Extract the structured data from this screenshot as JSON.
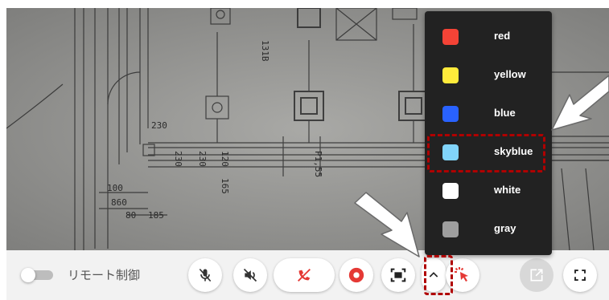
{
  "controls": {
    "remote_control_label": "リモート制御",
    "remote_control_on": false
  },
  "color_menu": {
    "selected": "skyblue",
    "items": [
      {
        "label": "red",
        "color": "#f44336"
      },
      {
        "label": "yellow",
        "color": "#ffeb3b"
      },
      {
        "label": "blue",
        "color": "#2962ff"
      },
      {
        "label": "skyblue",
        "color": "#81d4fa"
      },
      {
        "label": "white",
        "color": "#ffffff"
      },
      {
        "label": "gray",
        "color": "#9e9e9e"
      }
    ]
  },
  "feed": {
    "blueprint_labels": {
      "l1": "131B",
      "l2": "230",
      "l3": "230",
      "l4": "120",
      "l5": "165",
      "l6": "P1,55",
      "l7": "100",
      "l8": "860",
      "l9": "80",
      "l10": "185",
      "l11": "230"
    }
  },
  "colors": {
    "accent_red": "#e53935",
    "annotation": "#b00000"
  },
  "icons": {
    "mic": "mic-off-icon",
    "speaker": "speaker-off-icon",
    "hangup": "call-end-icon",
    "record": "record-icon",
    "screen": "screen-capture-icon",
    "expand": "chevron-up-icon",
    "pointer": "pointer-icon",
    "popout": "open-in-new-icon",
    "fullscreen": "fullscreen-icon"
  }
}
